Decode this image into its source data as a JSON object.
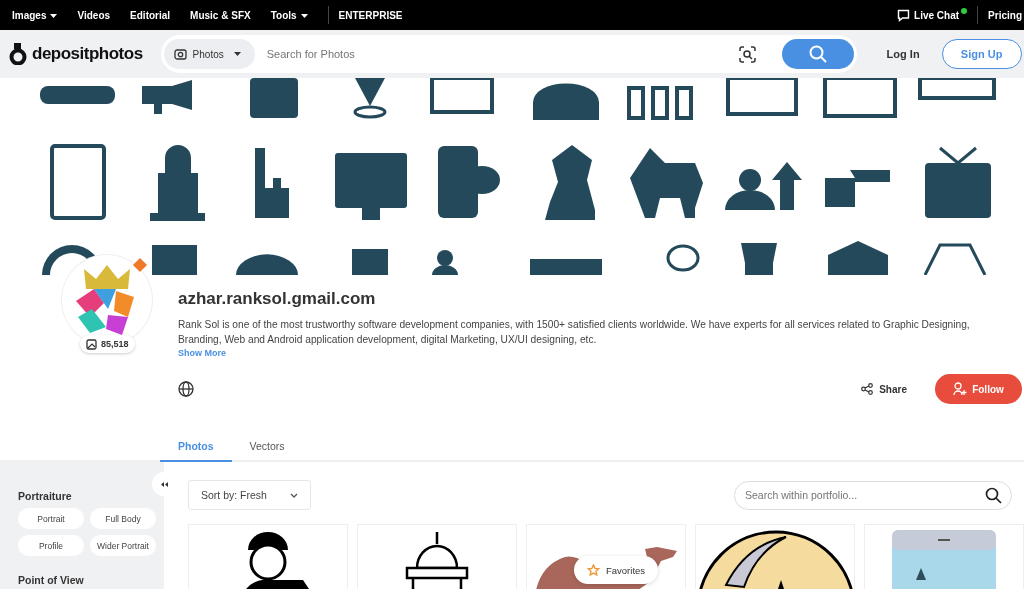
{
  "top_nav": {
    "items": [
      {
        "label": "Images",
        "dropdown": true
      },
      {
        "label": "Videos",
        "dropdown": false
      },
      {
        "label": "Editorial",
        "dropdown": false
      },
      {
        "label": "Music & SFX",
        "dropdown": false
      },
      {
        "label": "Tools",
        "dropdown": true
      }
    ],
    "enterprise": "ENTERPRISE",
    "live_chat": {
      "label": "Live Chat",
      "online": true
    },
    "pricing": "Pricing"
  },
  "header": {
    "logo": "depositphotos",
    "search": {
      "category": "Photos",
      "placeholder": "Search for Photos"
    },
    "login": "Log In",
    "signup": "Sign Up"
  },
  "profile": {
    "name": "azhar.ranksol.gmail.com",
    "files_count": "85,518",
    "premium": true,
    "description": "Rank Sol is one of the most trustworthy software development companies, with 1500+ satisfied clients worldwide. We have experts for all services related to Graphic Designing, Branding, Web and Android application development, digital Marketing, UX/UI designing, etc.",
    "show_more": "Show More",
    "share": "Share",
    "follow": "Follow"
  },
  "tabs": [
    {
      "label": "Photos",
      "selected": true
    },
    {
      "label": "Vectors",
      "selected": false
    }
  ],
  "sidebar": {
    "sections": [
      {
        "title": "Portraiture",
        "chips": [
          "Portrait",
          "Full Body",
          "Profile",
          "Wider Portrait"
        ]
      },
      {
        "title": "Point of View"
      }
    ]
  },
  "sort": {
    "label": "Sort by:",
    "value": "Fresh"
  },
  "portfolio_search": {
    "placeholder": "Search within portfolio..."
  },
  "thumbnails": [
    {
      "kind": "person"
    },
    {
      "kind": "dome"
    },
    {
      "kind": "camel"
    },
    {
      "kind": "moon"
    },
    {
      "kind": "phone"
    }
  ],
  "favorites": "Favorites"
}
